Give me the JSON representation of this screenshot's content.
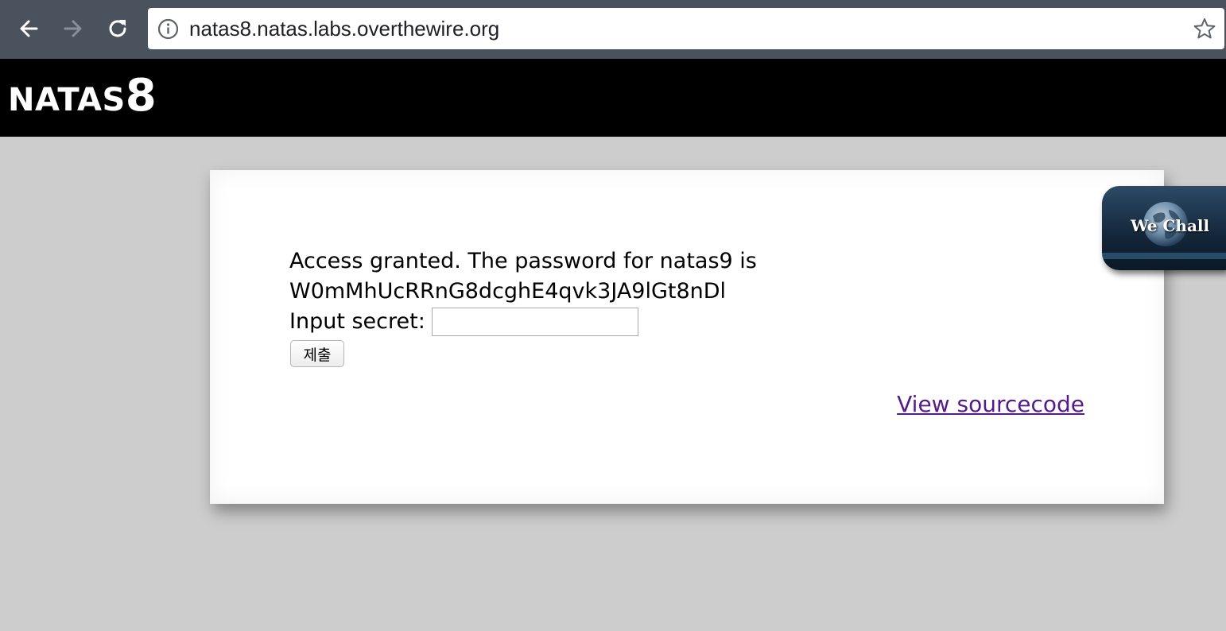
{
  "browser": {
    "url": "natas8.natas.labs.overthewire.org",
    "icons": [
      "back-icon",
      "forward-icon",
      "reload-icon",
      "info-icon",
      "bookmark-star-icon"
    ]
  },
  "header": {
    "title_word": "NATAS",
    "title_number": "8"
  },
  "content": {
    "message_line1": "Access granted. The password for natas9 is",
    "message_line2": "W0mMhUcRRnG8dcghE4qvk3JA9lGt8nDl",
    "secret_label": "Input secret:",
    "secret_value": "",
    "submit_label": "제출",
    "source_link": "View sourcecode"
  },
  "badge": {
    "label": "We Chall"
  },
  "colors": {
    "toolbar": "#4a525e",
    "header_bg": "#000000",
    "page_bg": "#cdcdcd",
    "link_visited": "#551a8b"
  }
}
